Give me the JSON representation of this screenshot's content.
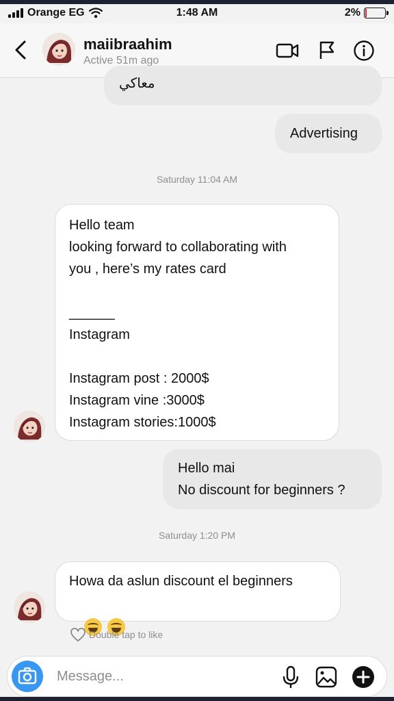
{
  "status_bar": {
    "carrier": "Orange EG",
    "time": "1:48 AM",
    "battery": "2%"
  },
  "header": {
    "username": "maiibraahim",
    "active_status": "Active 51m ago"
  },
  "messages": {
    "partial_in": "معاكي",
    "out_advertising": "Advertising",
    "timestamp_1": "Saturday 11:04 AM",
    "rate_card": {
      "line1": "Hello team",
      "line2": "looking forward to collaborating with",
      "line3": "you , here’s my rates card",
      "divider": "______",
      "line4": "Instagram",
      "line5": "Instagram post : 2000$",
      "line6": "Instagram vine :3000$",
      "line7": "Instagram stories:1000$"
    },
    "out_reply": {
      "line1": "Hello mai",
      "line2": "No discount for beginners ?"
    },
    "timestamp_2": "Saturday 1:20 PM",
    "last_in": "Howa da aslun discount el beginners",
    "like_hint": "Double tap to like"
  },
  "composer": {
    "placeholder": "Message..."
  },
  "icons": {
    "header": [
      "back-chevron-icon",
      "video-call-icon",
      "flag-icon",
      "info-icon"
    ],
    "composer": [
      "camera-icon",
      "microphone-icon",
      "gallery-icon",
      "add-icon"
    ],
    "emoji": "grinning-sweat-emoji"
  },
  "colors": {
    "accent": "#3897f0",
    "incoming_bubble": "#ffffff",
    "outgoing_bubble": "#e8e8e8",
    "timestamp": "#8e8e8e"
  }
}
